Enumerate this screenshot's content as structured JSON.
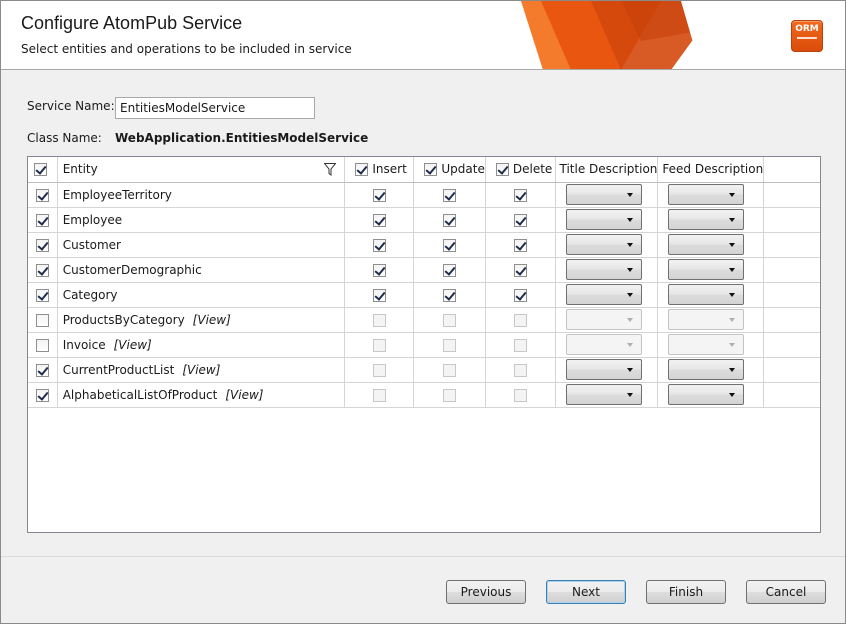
{
  "header": {
    "title": "Configure AtomPub Service",
    "subtitle": "Select entities and operations to be included in service",
    "badge": "ORM",
    "accent": "#e8560f"
  },
  "form": {
    "service_name_label": "Service Name:",
    "service_name_value": "EntitiesModelService",
    "class_name_label": "Class Name:",
    "class_name_value": "WebApplication.EntitiesModelService"
  },
  "grid": {
    "columns": {
      "entity": "Entity",
      "insert": "Insert",
      "update": "Update",
      "delete": "Delete",
      "title_description": "Title Description",
      "feed_description": "Feed Description"
    },
    "header_checks": {
      "select": true,
      "insert": true,
      "update": true,
      "delete": true
    },
    "rows": [
      {
        "name": "EmployeeTerritory",
        "view": "",
        "selected": true,
        "insert": true,
        "update": true,
        "delete": true,
        "ops_enabled": true,
        "combos_enabled": true
      },
      {
        "name": "Employee",
        "view": "",
        "selected": true,
        "insert": true,
        "update": true,
        "delete": true,
        "ops_enabled": true,
        "combos_enabled": true
      },
      {
        "name": "Customer",
        "view": "",
        "selected": true,
        "insert": true,
        "update": true,
        "delete": true,
        "ops_enabled": true,
        "combos_enabled": true
      },
      {
        "name": "CustomerDemographic",
        "view": "",
        "selected": true,
        "insert": true,
        "update": true,
        "delete": true,
        "ops_enabled": true,
        "combos_enabled": true
      },
      {
        "name": "Category",
        "view": "",
        "selected": true,
        "insert": true,
        "update": true,
        "delete": true,
        "ops_enabled": true,
        "combos_enabled": true
      },
      {
        "name": "ProductsByCategory",
        "view": "[View]",
        "selected": false,
        "insert": false,
        "update": false,
        "delete": false,
        "ops_enabled": false,
        "combos_enabled": false
      },
      {
        "name": "Invoice",
        "view": "[View]",
        "selected": false,
        "insert": false,
        "update": false,
        "delete": false,
        "ops_enabled": false,
        "combos_enabled": false
      },
      {
        "name": "CurrentProductList",
        "view": "[View]",
        "selected": true,
        "insert": false,
        "update": false,
        "delete": false,
        "ops_enabled": false,
        "combos_enabled": true
      },
      {
        "name": "AlphabeticalListOfProduct",
        "view": "[View]",
        "selected": true,
        "insert": false,
        "update": false,
        "delete": false,
        "ops_enabled": false,
        "combos_enabled": true
      }
    ]
  },
  "buttons": {
    "previous": "Previous",
    "next": "Next",
    "finish": "Finish",
    "cancel": "Cancel"
  }
}
